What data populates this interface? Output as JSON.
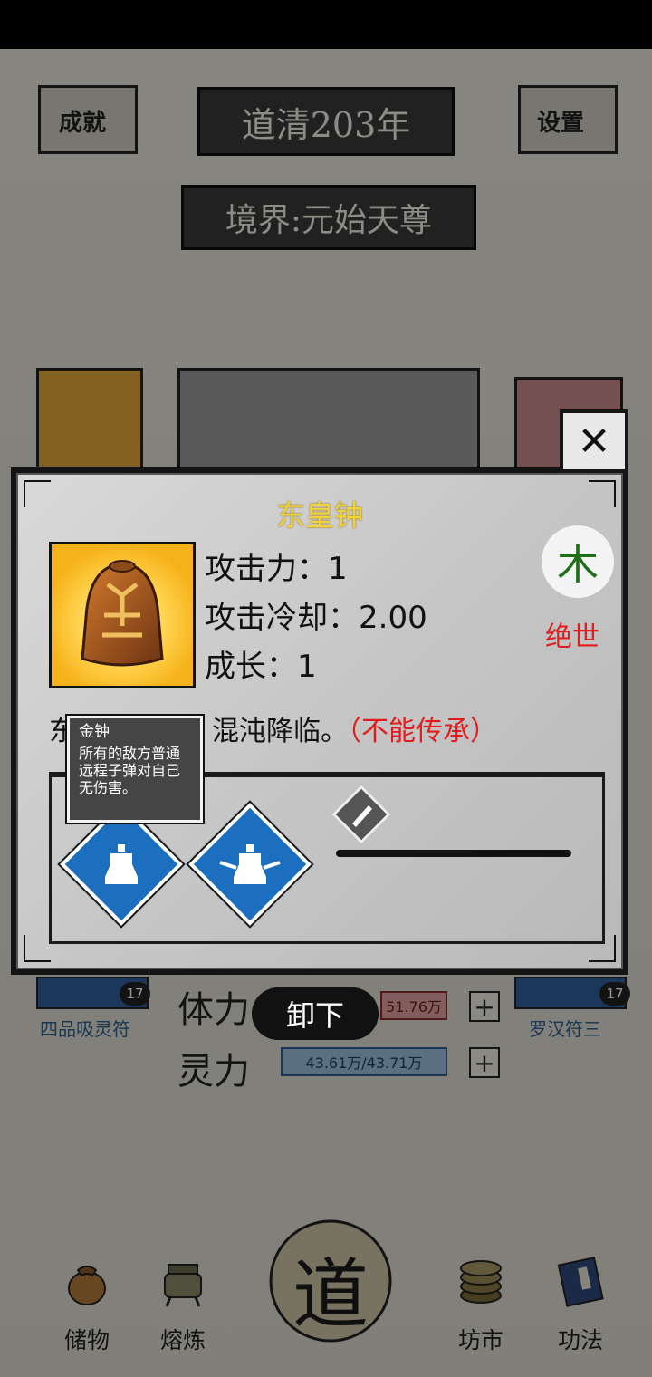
{
  "header": {
    "achievement_label": "成就",
    "year_label": "道清203年",
    "settings_label": "设置",
    "realm_label": "境界:元始天尊"
  },
  "stats": {
    "hp_label": "体力",
    "hp_value": "51.76万",
    "mp_label": "灵力",
    "mp_value": "43.61万/43.71万",
    "plus_symbol": "+"
  },
  "side_items": {
    "left_name": "四品吸灵符",
    "left_count": "17",
    "right_name": "罗汉符三",
    "right_count": "17"
  },
  "dialog": {
    "item_name": "东皇钟",
    "attack_label": "攻击力：1",
    "cooldown_label": "攻击冷却：2.00",
    "growth_label": "成长：1",
    "element": "木",
    "rarity": "绝世",
    "description_prefix": "东",
    "description_main": "混沌降临。",
    "description_note": "（不能传承）",
    "tooltip_title": "金钟",
    "tooltip_text": "所有的敌方普通远程子弹对自己无伤害。",
    "close_symbol": "✕",
    "unequip_label": "卸下"
  },
  "nav": [
    {
      "label": "储物",
      "icon": "pouch-icon"
    },
    {
      "label": "熔炼",
      "icon": "cauldron-icon"
    },
    {
      "label": "道",
      "icon": "dao-icon"
    },
    {
      "label": "坊市",
      "icon": "coins-icon"
    },
    {
      "label": "功法",
      "icon": "book-icon"
    }
  ],
  "colors": {
    "item_name": "#f1d23b",
    "element": "#1e6e18",
    "rarity": "#e21c1c",
    "skill_tile": "#1c6fbf",
    "portrait_bg": "#f6b21a"
  }
}
